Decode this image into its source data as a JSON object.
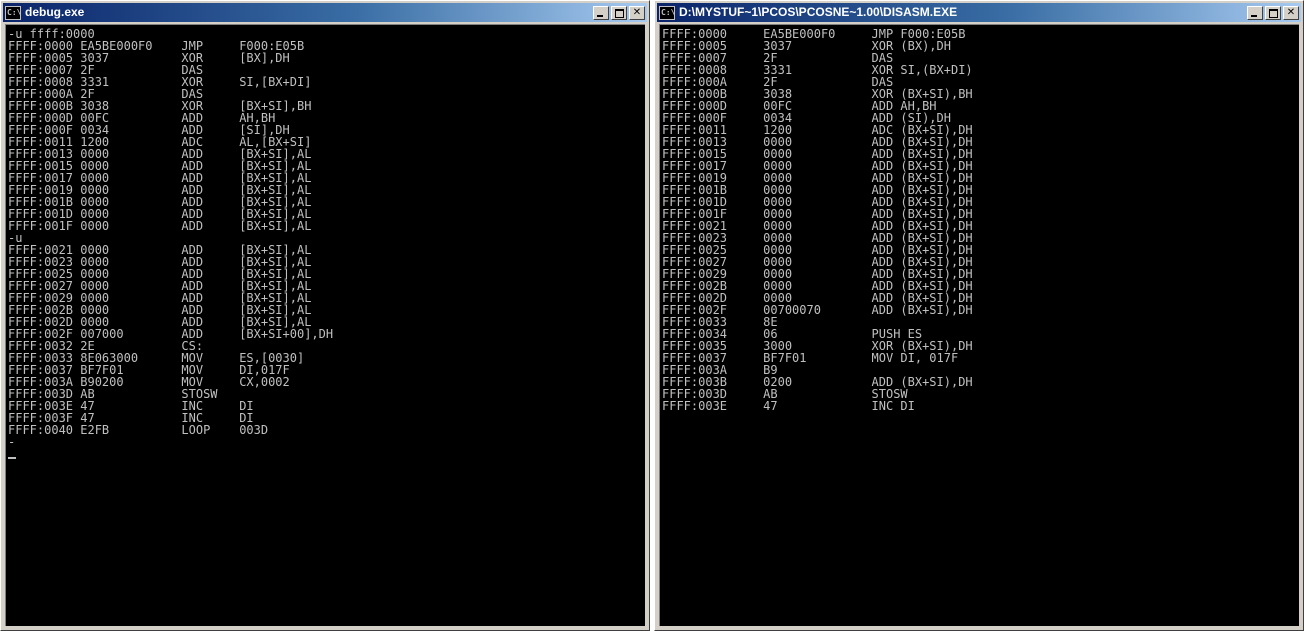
{
  "left_window": {
    "title": "debug.exe",
    "icon_label": "C:\\",
    "lines": [
      "-u ffff:0000",
      "FFFF:0000 EA5BE000F0    JMP     F000:E05B",
      "FFFF:0005 3037          XOR     [BX],DH",
      "FFFF:0007 2F            DAS",
      "FFFF:0008 3331          XOR     SI,[BX+DI]",
      "FFFF:000A 2F            DAS",
      "FFFF:000B 3038          XOR     [BX+SI],BH",
      "FFFF:000D 00FC          ADD     AH,BH",
      "FFFF:000F 0034          ADD     [SI],DH",
      "FFFF:0011 1200          ADC     AL,[BX+SI]",
      "FFFF:0013 0000          ADD     [BX+SI],AL",
      "FFFF:0015 0000          ADD     [BX+SI],AL",
      "FFFF:0017 0000          ADD     [BX+SI],AL",
      "FFFF:0019 0000          ADD     [BX+SI],AL",
      "FFFF:001B 0000          ADD     [BX+SI],AL",
      "FFFF:001D 0000          ADD     [BX+SI],AL",
      "FFFF:001F 0000          ADD     [BX+SI],AL",
      "-u",
      "FFFF:0021 0000          ADD     [BX+SI],AL",
      "FFFF:0023 0000          ADD     [BX+SI],AL",
      "FFFF:0025 0000          ADD     [BX+SI],AL",
      "FFFF:0027 0000          ADD     [BX+SI],AL",
      "FFFF:0029 0000          ADD     [BX+SI],AL",
      "FFFF:002B 0000          ADD     [BX+SI],AL",
      "FFFF:002D 0000          ADD     [BX+SI],AL",
      "FFFF:002F 007000        ADD     [BX+SI+00],DH",
      "FFFF:0032 2E            CS:",
      "FFFF:0033 8E063000      MOV     ES,[0030]",
      "FFFF:0037 BF7F01        MOV     DI,017F",
      "FFFF:003A B90200        MOV     CX,0002",
      "FFFF:003D AB            STOSW",
      "FFFF:003E 47            INC     DI",
      "FFFF:003F 47            INC     DI",
      "FFFF:0040 E2FB          LOOP    003D",
      "-"
    ]
  },
  "right_window": {
    "title": "D:\\MYSTUF~1\\PCOS\\PCOSNE~1.00\\DISASM.EXE",
    "icon_label": "C:\\",
    "lines": [
      "FFFF:0000     EA5BE000F0     JMP F000:E05B",
      "FFFF:0005     3037           XOR (BX),DH",
      "FFFF:0007     2F             DAS",
      "FFFF:0008     3331           XOR SI,(BX+DI)",
      "FFFF:000A     2F             DAS",
      "FFFF:000B     3038           XOR (BX+SI),BH",
      "FFFF:000D     00FC           ADD AH,BH",
      "FFFF:000F     0034           ADD (SI),DH",
      "FFFF:0011     1200           ADC (BX+SI),DH",
      "FFFF:0013     0000           ADD (BX+SI),DH",
      "FFFF:0015     0000           ADD (BX+SI),DH",
      "FFFF:0017     0000           ADD (BX+SI),DH",
      "FFFF:0019     0000           ADD (BX+SI),DH",
      "FFFF:001B     0000           ADD (BX+SI),DH",
      "FFFF:001D     0000           ADD (BX+SI),DH",
      "FFFF:001F     0000           ADD (BX+SI),DH",
      "FFFF:0021     0000           ADD (BX+SI),DH",
      "FFFF:0023     0000           ADD (BX+SI),DH",
      "FFFF:0025     0000           ADD (BX+SI),DH",
      "FFFF:0027     0000           ADD (BX+SI),DH",
      "FFFF:0029     0000           ADD (BX+SI),DH",
      "FFFF:002B     0000           ADD (BX+SI),DH",
      "FFFF:002D     0000           ADD (BX+SI),DH",
      "FFFF:002F     00700070       ADD (BX+SI),DH",
      "FFFF:0033     8E",
      "FFFF:0034     06             PUSH ES",
      "FFFF:0035     3000           XOR (BX+SI),DH",
      "FFFF:0037     BF7F01         MOV DI, 017F",
      "FFFF:003A     B9",
      "FFFF:003B     0200           ADD (BX+SI),DH",
      "FFFF:003D     AB             STOSW",
      "FFFF:003E     47             INC DI"
    ]
  },
  "colors": {
    "console_bg": "#000000",
    "console_fg": "#c0c0c0",
    "titlebar_start": "#0a246a",
    "titlebar_end": "#a6caf0"
  }
}
